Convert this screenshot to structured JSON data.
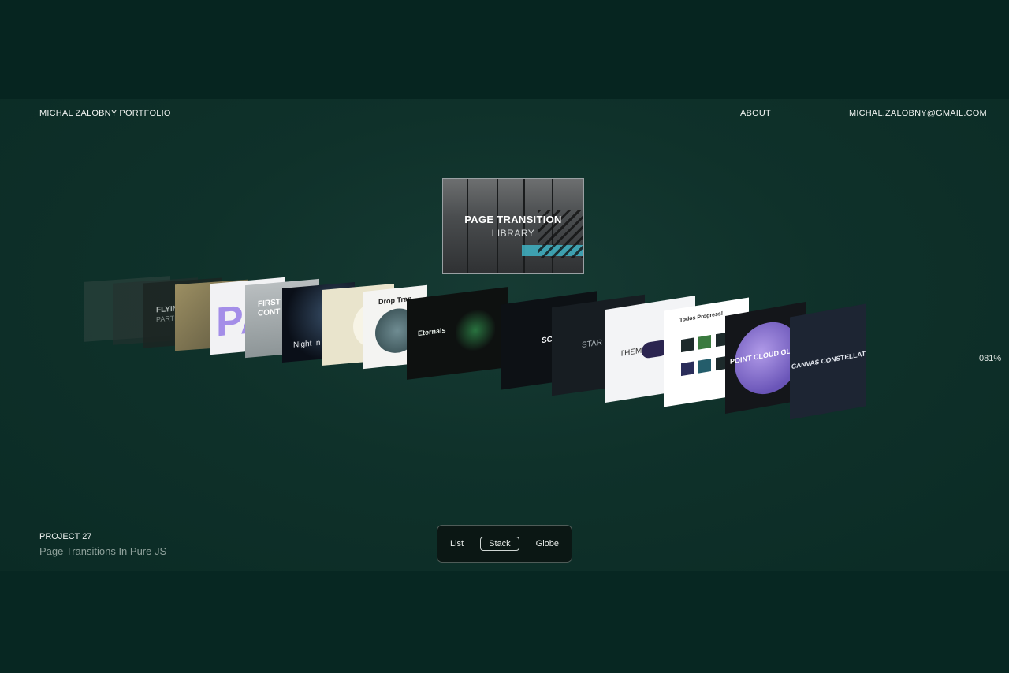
{
  "header": {
    "brand": "MICHAL ZALOBNY PORTFOLIO",
    "about": "ABOUT",
    "email": "MICHAL.ZALOBNY@GMAIL.COM"
  },
  "featured": {
    "title_line1": "PAGE TRANSITION",
    "title_line2": "LIBRARY"
  },
  "carousel_labels": {
    "flying": "FLYING",
    "flying_sub": "PARTICLES",
    "first_contact": "FIRST",
    "first_contact_sub": "CONT",
    "night": "Night In",
    "drop": "Drop Tran",
    "eternals": "Eternals",
    "scroll": "SCR",
    "star": "STAR SH",
    "theme": "THEME",
    "todo": "Todos Progress!",
    "point_cloud": "POINT CLOUD GLOBE",
    "canvas": "CANVAS CONSTELLATION"
  },
  "progress": "081%",
  "project": {
    "number": "PROJECT 27",
    "title": "Page Transitions In Pure JS"
  },
  "view_switcher": {
    "list": "List",
    "stack": "Stack",
    "globe": "Globe",
    "active": "Stack"
  }
}
